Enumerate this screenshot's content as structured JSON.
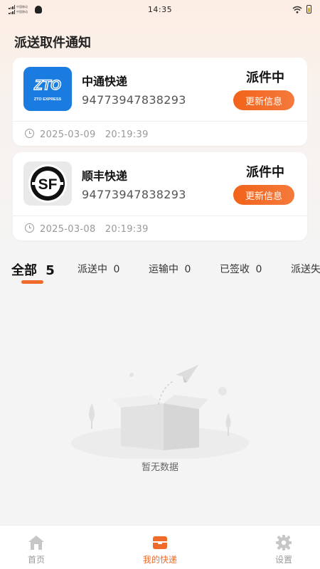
{
  "status_bar": {
    "time": "14:35",
    "sim1": "中国移动",
    "sim2": "中国移动"
  },
  "page": {
    "title": "派送取件通知"
  },
  "cards": [
    {
      "courier": "中通快递",
      "tracking_number": "94773947838293",
      "status": "派件中",
      "button_label": "更新信息",
      "timestamp": "2025-03-09　20:19:39",
      "logo_text": "ZTO",
      "logo_subtext": "ZTO EXPRESS",
      "logo_color": "#1a7ce0"
    },
    {
      "courier": "顺丰快递",
      "tracking_number": "94773947838293",
      "status": "派件中",
      "button_label": "更新信息",
      "timestamp": "2025-03-08　20:19:39",
      "logo_text": "SF",
      "logo_color": "#111111"
    }
  ],
  "tabs": [
    {
      "label": "全部",
      "count": "5",
      "active": true
    },
    {
      "label": "派送中",
      "count": "0"
    },
    {
      "label": "运输中",
      "count": "0"
    },
    {
      "label": "已签收",
      "count": "0"
    },
    {
      "label": "派送失",
      "count": ""
    }
  ],
  "empty_state": {
    "text": "暂无数据"
  },
  "tabbar": {
    "items": [
      {
        "label": "首页",
        "icon": "home-icon"
      },
      {
        "label": "我的快递",
        "icon": "package-icon",
        "active": true
      },
      {
        "label": "设置",
        "icon": "gear-icon"
      }
    ]
  },
  "colors": {
    "accent": "#f06b2a",
    "button_gradient_start": "#f2631a",
    "button_gradient_end": "#f47a3c"
  }
}
